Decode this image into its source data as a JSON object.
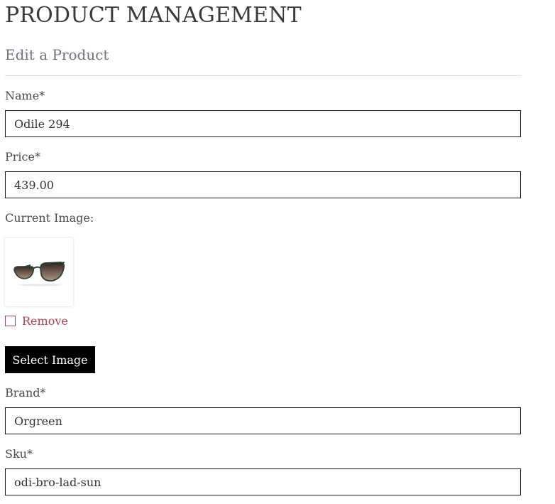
{
  "header": {
    "title": "PRODUCT MANAGEMENT",
    "subtitle": "Edit a Product"
  },
  "form": {
    "name": {
      "label": "Name*",
      "value": "Odile 294"
    },
    "price": {
      "label": "Price*",
      "value": "439.00"
    },
    "image": {
      "label": "Current Image:",
      "thumbnail_icon": "sunglasses-image",
      "remove_label": "Remove",
      "remove_checked": false,
      "select_button_label": "Select Image"
    },
    "brand": {
      "label": "Brand*",
      "value": "Orgreen"
    },
    "sku": {
      "label": "Sku*",
      "value": "odi-bro-lad-sun"
    }
  },
  "colors": {
    "remove_accent": "#b73f4f",
    "button_bg": "#000000",
    "button_text": "#ffffff"
  }
}
